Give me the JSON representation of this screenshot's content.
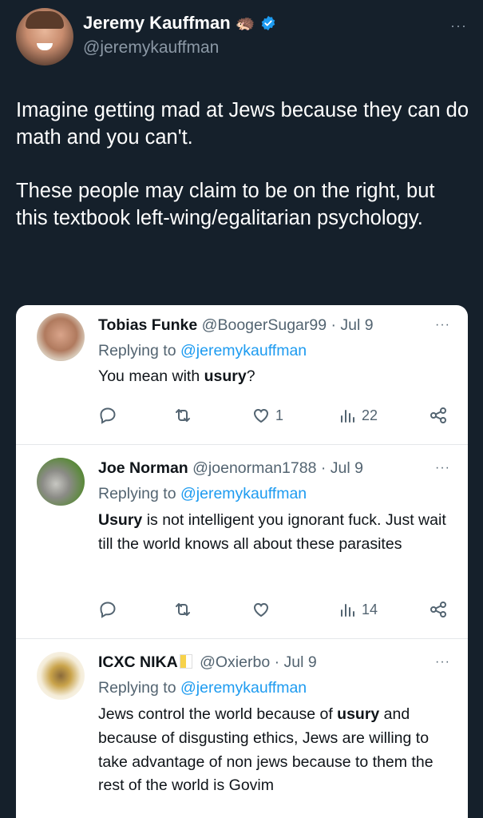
{
  "author": {
    "name": "Jeremy Kauffman",
    "handle": "@jeremykauffman",
    "emoji": "🦔",
    "more": "···"
  },
  "tweet": {
    "paragraph1": "Imagine getting mad at Jews because they can do math and you can't.",
    "paragraph2": "These people may claim to be on the right, but this textbook left-wing/egalitarian psychology."
  },
  "replies": [
    {
      "name": "Tobias Funke",
      "handle": "@BoogerSugar99",
      "date": "· Jul 9",
      "replying_prefix": "Replying to",
      "replying_to": "@jeremykauffman",
      "body_pre": "You mean with ",
      "body_bold": "usury",
      "body_post": "?",
      "likes": "1",
      "views": "22",
      "more": "···"
    },
    {
      "name": "Joe Norman",
      "handle": "@joenorman1788",
      "date": "· Jul 9",
      "replying_prefix": "Replying to",
      "replying_to": "@jeremykauffman",
      "body_bold": "Usury",
      "body_post": " is not intelligent you ignorant fuck. Just wait till the world knows all about these parasites",
      "likes": "",
      "views": "14",
      "more": "···"
    },
    {
      "name": "ICXC NIKA",
      "handle": "@Oxierbo",
      "date": "· Jul 9",
      "replying_prefix": "Replying to",
      "replying_to": "@jeremykauffman",
      "body_pre": "Jews control the world because of ",
      "body_bold": "usury",
      "body_post": " and because of disgusting ethics, Jews are willing to take advantage of non jews because to them the rest of the world is Govim",
      "more": "···"
    }
  ],
  "colors": {
    "background": "#15202b",
    "accent": "#1d9bf0",
    "muted": "#8b98a5"
  }
}
